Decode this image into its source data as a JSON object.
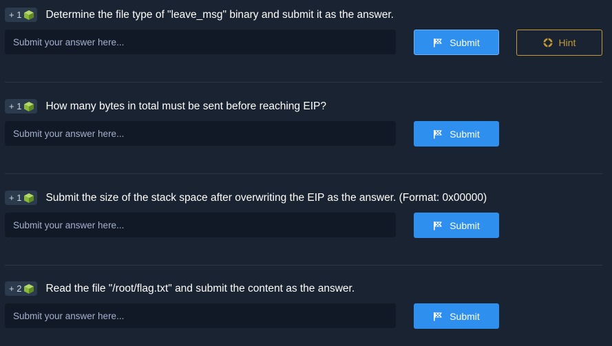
{
  "questions": [
    {
      "points": "+ 1",
      "text": "Determine the file type of \"leave_msg\" binary and submit it as the answer.",
      "placeholder": "Submit your answer here...",
      "submit_label": "Submit",
      "hint_label": "Hint"
    },
    {
      "points": "+ 1",
      "text": "How many bytes in total must be sent before reaching EIP?",
      "placeholder": "Submit your answer here...",
      "submit_label": "Submit"
    },
    {
      "points": "+ 1",
      "text": "Submit the size of the stack space after overwriting the EIP as the answer. (Format: 0x00000)",
      "placeholder": "Submit your answer here...",
      "submit_label": "Submit"
    },
    {
      "points": "+ 2",
      "text": "Read the file \"/root/flag.txt\" and submit the content as the answer.",
      "placeholder": "Submit your answer here...",
      "submit_label": "Submit"
    }
  ],
  "colors": {
    "background": "#1a2332",
    "input_bg": "#111927",
    "submit_bg": "#2f8fee",
    "hint_accent": "#c49a3a",
    "badge_bg": "#2c3a4e",
    "cube_green": "#8ab839"
  },
  "icons": {
    "points": "cube-icon",
    "submit": "flag-icon",
    "hint": "lifebuoy-icon"
  }
}
